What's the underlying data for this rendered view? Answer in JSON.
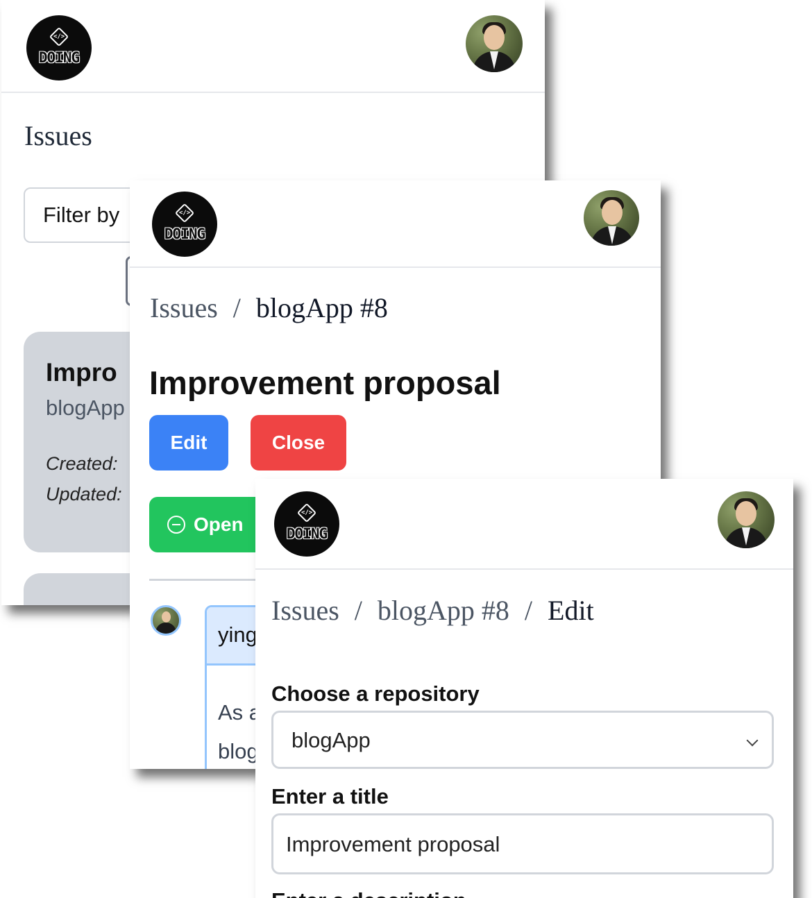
{
  "logo": {
    "badge": "</>",
    "text": "DOING"
  },
  "list_view": {
    "page_title": "Issues",
    "filter_placeholder": "Filter by",
    "issue_card": {
      "title": "Impro",
      "repo": "blogApp",
      "created_label": "Created:",
      "updated_label": "Updated:"
    }
  },
  "detail_view": {
    "breadcrumb": {
      "root": "Issues",
      "separator": "/",
      "current": "blogApp #8"
    },
    "title": "Improvement proposal",
    "edit_label": "Edit",
    "close_label": "Close",
    "status_label": "Open",
    "comment": {
      "author": "ying",
      "body_line1": "As a",
      "body_line2": "blog"
    },
    "colors": {
      "edit": "#3b82f6",
      "close": "#ef4444",
      "open": "#22c55e"
    }
  },
  "edit_view": {
    "breadcrumb": {
      "root": "Issues",
      "separator": "/",
      "middle": "blogApp #8",
      "current": "Edit"
    },
    "repo_label": "Choose a repository",
    "repo_value": "blogApp",
    "title_label": "Enter a title",
    "title_value": "Improvement proposal",
    "description_label": "Enter a description"
  }
}
